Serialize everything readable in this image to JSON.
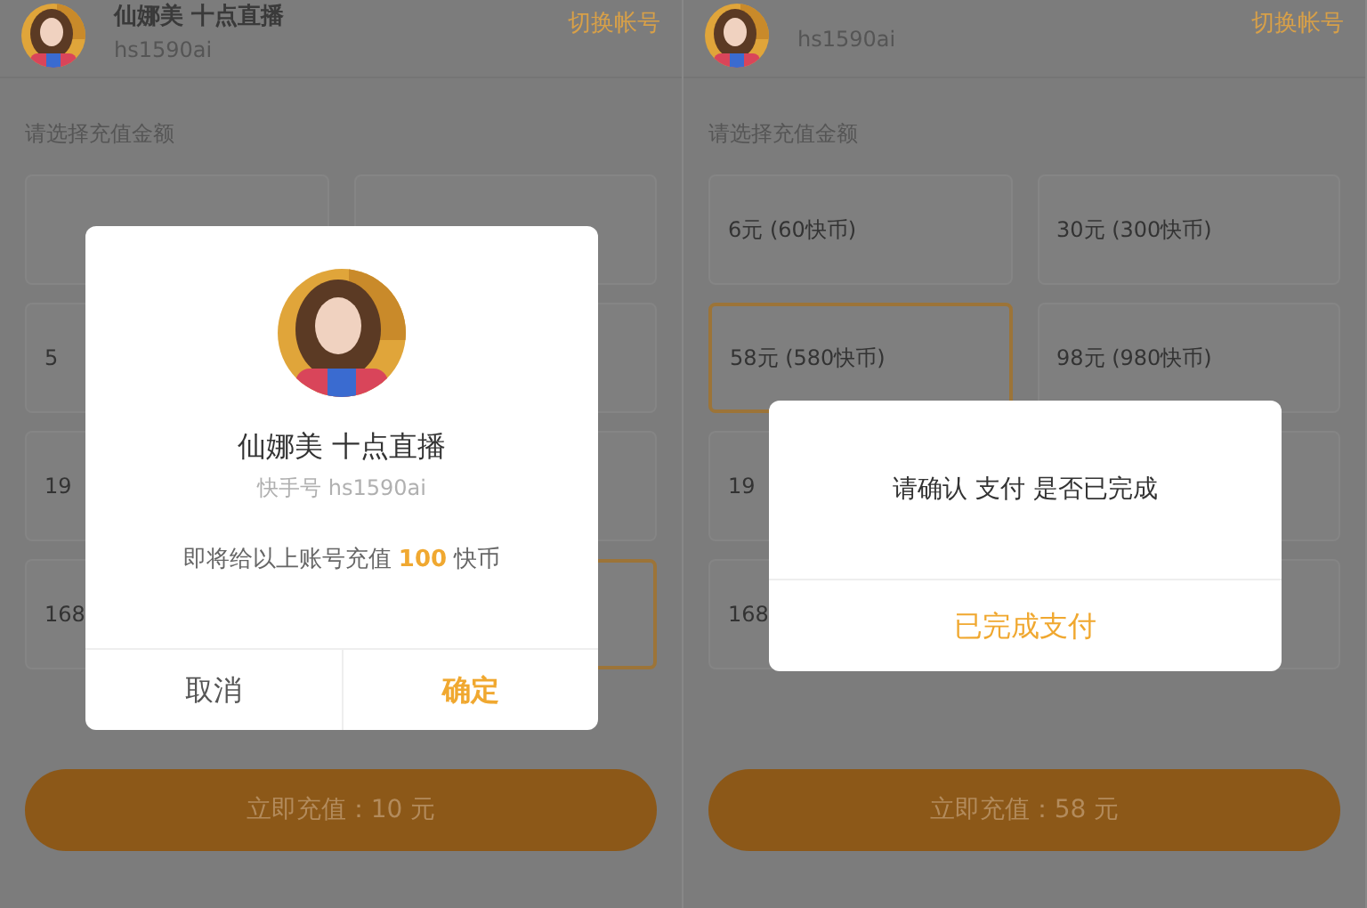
{
  "panes": [
    {
      "header": {
        "name": "仙娜美 十点直播",
        "account_id": "hs1590ai",
        "switch_label": "切换帐号"
      },
      "amount_prompt": "请选择充值金额",
      "options": [
        {
          "selected": false
        },
        {
          "selected": false
        },
        {
          "label": "5",
          "selected": false
        },
        {
          "selected": false
        },
        {
          "label": "19",
          "selected": false
        },
        {
          "selected": false
        },
        {
          "label": "168",
          "selected": false
        },
        {
          "selected": true
        }
      ],
      "submit_button": "立即充值：10 元",
      "dialog": {
        "kind": "account_confirm",
        "name": "仙娜美 十点直播",
        "account_label": "快手号 hs1590ai",
        "message_before": "即将给以上账号充值",
        "amount": "100",
        "message_after": "快币",
        "buttons": [
          {
            "label": "取消",
            "kind": "cancel"
          },
          {
            "label": "确定",
            "kind": "confirm"
          }
        ]
      }
    },
    {
      "header": {
        "account_id": "hs1590ai",
        "switch_label": "切换帐号"
      },
      "amount_prompt": "请选择充值金额",
      "options": [
        {
          "label": "6元 (60快币)",
          "selected": false
        },
        {
          "label": "30元 (300快币)",
          "selected": false
        },
        {
          "label": "58元 (580快币)",
          "selected": true
        },
        {
          "label": "98元 (980快币)",
          "selected": false
        },
        {
          "label": "19",
          "selected": false
        },
        {
          "selected": false
        },
        {
          "label": "168",
          "selected": false
        },
        {
          "selected": false
        }
      ],
      "submit_button": "立即充值：58 元",
      "dialog": {
        "kind": "payment_check",
        "message": "请确认 支付 是否已完成",
        "buttons": [
          {
            "label": "已完成支付",
            "kind": "confirm"
          }
        ]
      }
    }
  ]
}
